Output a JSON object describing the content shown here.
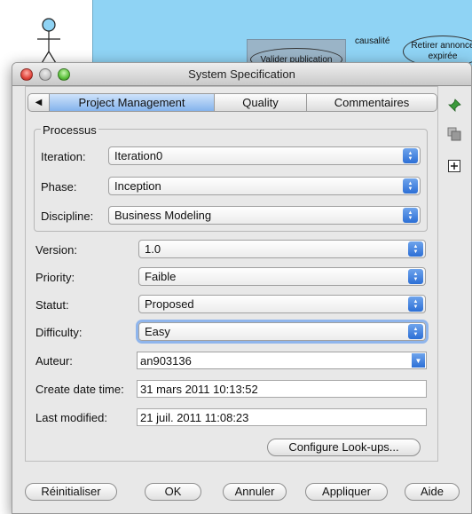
{
  "background": {
    "node_validate": "Valider publication",
    "node_retire": "Retirer annonce expirée",
    "relation": "causalité"
  },
  "window": {
    "title": "System Specification"
  },
  "tabs": [
    "Project Management",
    "Quality",
    "Commentaires"
  ],
  "processus": {
    "legend": "Processus",
    "iteration": {
      "label": "Iteration:",
      "value": "Iteration0"
    },
    "phase": {
      "label": "Phase:",
      "value": "Inception"
    },
    "discipline": {
      "label": "Discipline:",
      "value": "Business Modeling"
    }
  },
  "fields": {
    "version": {
      "label": "Version:",
      "value": "1.0"
    },
    "priority": {
      "label": "Priority:",
      "value": "Faible"
    },
    "statut": {
      "label": "Statut:",
      "value": "Proposed"
    },
    "difficulty": {
      "label": "Difficulty:",
      "value": "Easy"
    },
    "auteur": {
      "label": "Auteur:",
      "value": "an903136"
    },
    "create_date": {
      "label": "Create date time:",
      "value": "31 mars 2011 10:13:52"
    },
    "last_modified": {
      "label": "Last modified:",
      "value": "21 juil. 2011 11:08:23"
    }
  },
  "buttons": {
    "configure": "Configure Look-ups...",
    "reset": "Réinitialiser",
    "ok": "OK",
    "cancel": "Annuler",
    "apply": "Appliquer",
    "help": "Aide"
  },
  "side_icons": [
    "pin-icon",
    "copy-icon",
    "add-icon"
  ],
  "colors": {
    "accent": "#2c6fd6",
    "active_tab": "#84b3ec",
    "diagram_bg": "#8fd3f4"
  }
}
